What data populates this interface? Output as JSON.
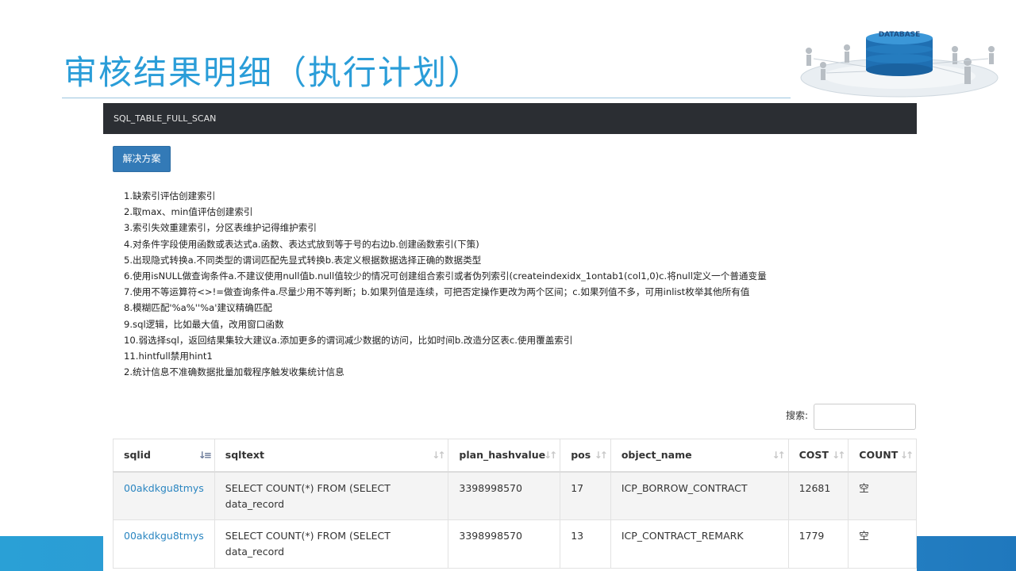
{
  "slide": {
    "title": "审核结果明细（执行计划）",
    "db_label": "DATABASE"
  },
  "panel": {
    "header": "SQL_TABLE_FULL_SCAN",
    "solution_button": "解决方案",
    "solutions": [
      "1.缺索引评估创建索引",
      "2.取max、min值评估创建索引",
      "3.索引失效重建索引，分区表维护记得维护索引",
      "4.对条件字段使用函数或表达式a.函数、表达式放到等于号的右边b.创建函数索引(下策)",
      "5.出现隐式转换a.不同类型的谓词匹配先显式转换b.表定义根据数据选择正确的数据类型",
      "6.使用isNULL做查询条件a.不建议使用null值b.null值较少的情况可创建组合索引或者伪列索引(createindexidx_1ontab1(col1,0)c.将null定义一个普通变量",
      "7.使用不等运算符<>!=做查询条件a.尽量少用不等判断；b.如果列值是连续，可把否定操作更改为两个区间；c.如果列值不多，可用inlist枚举其他所有值",
      "8.模糊匹配'%a%''%a'建议精确匹配",
      "9.sql逻辑，比如最大值，改用窗口函数",
      "10.弱选择sql，返回结果集较大建议a.添加更多的谓词减少数据的访问，比如时间b.改造分区表c.使用覆盖索引",
      "11.hintfull禁用hint1",
      "2.统计信息不准确数据批量加载程序触发收集统计信息"
    ],
    "search": {
      "label": "搜索:",
      "value": ""
    },
    "table": {
      "columns": [
        "sqlid",
        "sqltext",
        "plan_hashvalue",
        "pos",
        "object_name",
        "COST",
        "COUNT"
      ],
      "rows": [
        {
          "sqlid": "00akdkgu8tmys",
          "sqltext": "SELECT COUNT(*) FROM (SELECT data_record",
          "plan_hashvalue": "3398998570",
          "pos": "17",
          "object_name": "ICP_BORROW_CONTRACT",
          "cost": "12681",
          "count": "空"
        },
        {
          "sqlid": "00akdkgu8tmys",
          "sqltext": "SELECT COUNT(*) FROM (SELECT data_record",
          "plan_hashvalue": "3398998570",
          "pos": "13",
          "object_name": "ICP_CONTRACT_REMARK",
          "cost": "1779",
          "count": "空"
        }
      ]
    }
  }
}
